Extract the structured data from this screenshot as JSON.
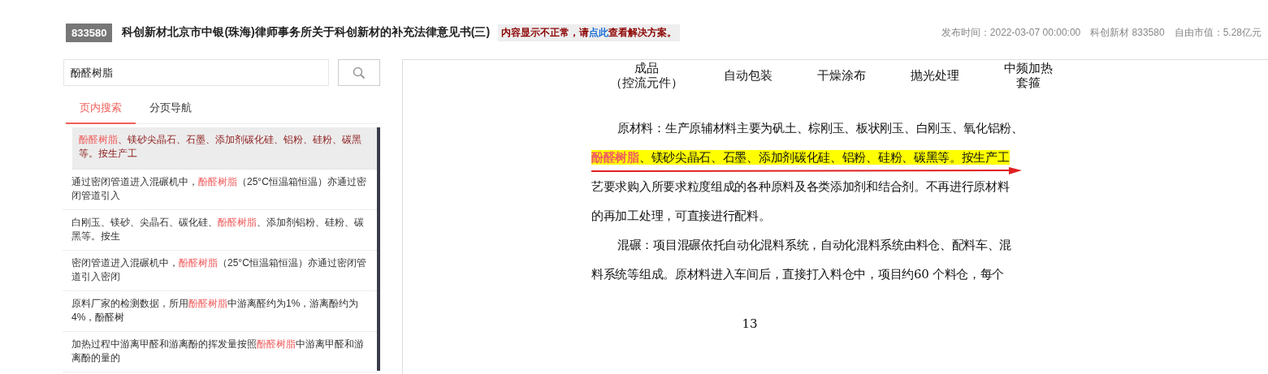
{
  "header": {
    "code": "833580",
    "title": "科创新材北京市中银(珠海)律师事务所关于科创新材的补充法律意见书(三)",
    "notice_before": "内容显示不正常，请",
    "notice_link": "点此",
    "notice_after": "查看解决方案。",
    "meta": [
      "发布时间：2022-03-07 00:00:00",
      "科创新材 833580",
      "自由市值：5.28亿元"
    ]
  },
  "search": {
    "value": "酚醛树脂"
  },
  "tabs": [
    {
      "label": "页内搜索",
      "selected": true
    },
    {
      "label": "分页导航",
      "selected": false
    }
  ],
  "results": [
    {
      "selected": true,
      "text": "**酚醛树脂**、镁砂尖晶石、石墨、添加剂碳化硅、铝粉、硅粉、碳黑等。按生产工"
    },
    {
      "selected": false,
      "text": "通过密闭管道进入混碾机中，**酚醛树脂**（25°C恒温箱恒温）亦通过密闭管道引入"
    },
    {
      "selected": false,
      "text": "白刚玉、镁砂、尖晶石、碳化硅、**酚醛树脂**、添加剂铝粉、硅粉、碳黑等。按生"
    },
    {
      "selected": false,
      "text": "密闭管道进入混碾机中，**酚醛树脂**（25°C恒温箱恒温）亦通过密闭管道引入密闭"
    },
    {
      "selected": false,
      "text": "原料厂家的检测数据，所用**酚醛树脂**中游离醛约为1%，游离酚约为4%，酚醛树"
    },
    {
      "selected": false,
      "text": "加热过程中游离甲醛和游离酚的挥发量按照**酚醛树脂**中游离甲醛和游离酚的量的"
    }
  ],
  "document": {
    "steps": [
      {
        "lines": [
          "成品",
          "（控流元件）"
        ]
      },
      {
        "lines": [
          "自动包装"
        ]
      },
      {
        "lines": [
          "干燥涂布"
        ]
      },
      {
        "lines": [
          "抛光处理"
        ]
      },
      {
        "lines": [
          "中频加热",
          "套箍"
        ]
      }
    ],
    "paragraphs": [
      {
        "lines": [
          {
            "text": "原材料：生产原辅材料主要为矾土、棕刚玉、板状刚玉、白刚玉、氧化铝粉、",
            "highlight": false
          },
          {
            "text": "**酚醛树脂**、镁砂尖晶石、石墨、添加剂碳化硅、铝粉、硅粉、碳黑等。按生产工",
            "highlight": true
          },
          {
            "text": "艺要求购入所要求粒度组成的各种原料及各类添加剂和结合剂。不再进行原材料",
            "highlight": false
          },
          {
            "text": "的再加工处理，可直接进行配料。",
            "highlight": false
          }
        ]
      },
      {
        "lines": [
          {
            "text": "混碾：项目混碾依托自动化混料系统，自动化混料系统由料仓、配料车、混",
            "highlight": false
          },
          {
            "text": "料系统等组成。原材料进入车间后，直接打入料仓中，项目约60 个料仓，每个",
            "highlight": false
          }
        ]
      }
    ],
    "page_number": "13"
  }
}
